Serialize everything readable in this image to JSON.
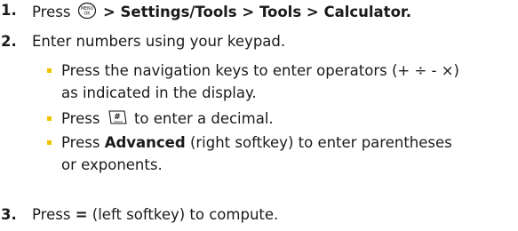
{
  "steps": [
    {
      "number": "1.",
      "pre": "Press",
      "icon": "menu-ok-key-icon",
      "post": "> Settings/Tools > Tools > Calculator."
    },
    {
      "number": "2.",
      "text": "Enter numbers using your keypad.",
      "bullets": [
        {
          "line1": "Press the navigation keys to enter operators (+ ÷ - ×)",
          "line2": "as indicated in the display."
        },
        {
          "pre": "Press",
          "icon": "pound-key-icon",
          "post": "to enter a decimal."
        },
        {
          "pre": "Press",
          "bold": "Advanced",
          "post": "(right softkey) to enter parentheses",
          "line2": "or exponents."
        }
      ]
    },
    {
      "number": "3.",
      "pre": "Press",
      "bold": "=",
      "post": "(left softkey) to compute."
    }
  ],
  "colors": {
    "text": "#1a1a1a",
    "bullet": "#f2c200"
  }
}
